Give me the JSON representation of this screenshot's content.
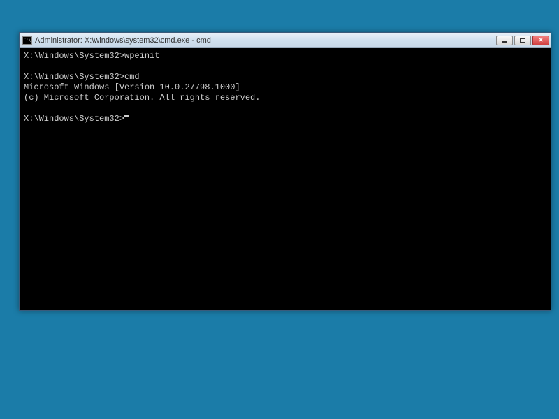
{
  "window": {
    "icon_text": "C:\\",
    "title": "Administrator: X:\\windows\\system32\\cmd.exe - cmd"
  },
  "terminal": {
    "lines": [
      "X:\\Windows\\System32>wpeinit",
      "",
      "X:\\Windows\\System32>cmd",
      "Microsoft Windows [Version 10.0.27798.1000]",
      "(c) Microsoft Corporation. All rights reserved.",
      ""
    ],
    "current_prompt": "X:\\Windows\\System32>"
  }
}
